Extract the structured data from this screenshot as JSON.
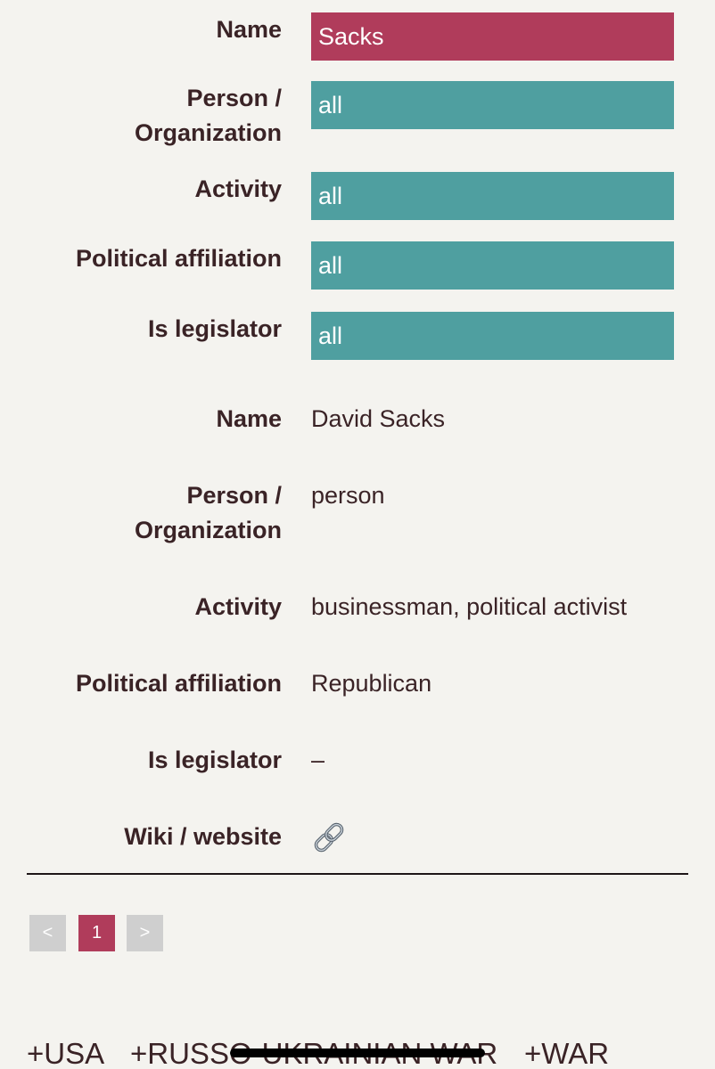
{
  "filters": {
    "name_label": "Name",
    "name_value": "Sacks",
    "person_org_label_line1": "Person /",
    "person_org_label_line2": "Organization",
    "person_org_value": "all",
    "activity_label": "Activity",
    "activity_value": "all",
    "political_label": "Political affiliation",
    "political_value": "all",
    "legislator_label": "Is legislator",
    "legislator_value": "all"
  },
  "record": {
    "name_label": "Name",
    "name_value": "David Sacks",
    "person_org_label_line1": "Person /",
    "person_org_label_line2": "Organization",
    "person_org_value": "person",
    "activity_label": "Activity",
    "activity_value": "businessman, political activist",
    "political_label": "Political affiliation",
    "political_value": "Republican",
    "legislator_label": "Is legislator",
    "legislator_value": "–",
    "wiki_label": "Wiki / website",
    "wiki_icon": "link-icon"
  },
  "pagination": {
    "prev": "<",
    "current": "1",
    "next": ">"
  },
  "tags": [
    "+USA",
    "+RUSSO-UKRAINIAN WAR",
    "+WAR"
  ],
  "colors": {
    "accent_red": "#b03c5b",
    "accent_teal": "#4f9fa0",
    "background": "#f4f3ef",
    "text": "#3a2326"
  }
}
